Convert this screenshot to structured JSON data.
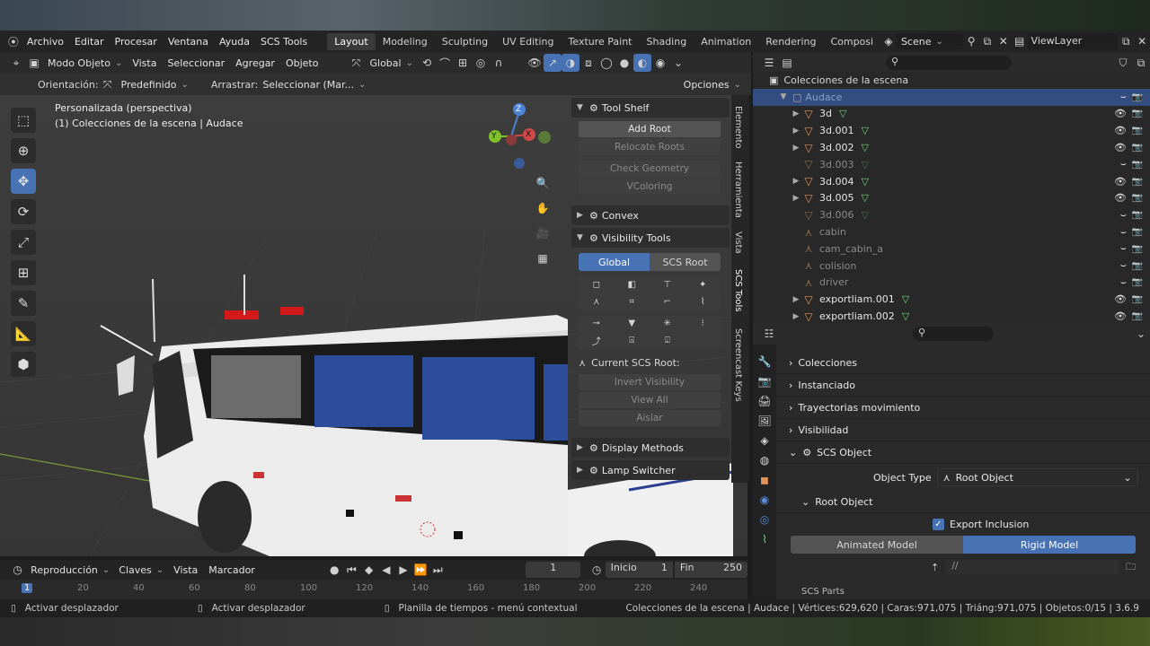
{
  "topbar": {
    "menus": [
      "Archivo",
      "Editar",
      "Procesar",
      "Ventana",
      "Ayuda",
      "SCS Tools"
    ],
    "workspaces": [
      "Layout",
      "Modeling",
      "Sculpting",
      "UV Editing",
      "Texture Paint",
      "Shading",
      "Animation",
      "Rendering",
      "Composi"
    ],
    "active_workspace": "Layout",
    "scene": "Scene",
    "view_layer": "ViewLayer"
  },
  "viewport_header": {
    "mode": "Modo Objeto",
    "menus": [
      "Vista",
      "Seleccionar",
      "Agregar",
      "Objeto"
    ],
    "transform": "Global",
    "orientation_label": "Orientación:",
    "orientation_value": "Predefinido",
    "drag_label": "Arrastrar:",
    "drag_value": "Seleccionar (Mar...",
    "options": "Opciones"
  },
  "viewport": {
    "view_name": "Personalizada (perspectiva)",
    "context": "(1) Colecciones de la escena | Audace",
    "gizmo": {
      "x": "X",
      "y": "Y",
      "z": "Z"
    }
  },
  "npanel": {
    "tool_shelf": "Tool Shelf",
    "add_root": "Add Root",
    "relocate_roots": "Relocate Roots",
    "check_geometry": "Check Geometry",
    "vcoloring": "VColoring",
    "convex": "Convex",
    "visibility_tools": "Visibility Tools",
    "global": "Global",
    "scs_root": "SCS Root",
    "current_root": "Current SCS Root:",
    "invert_visibility": "Invert Visibility",
    "view_all": "View All",
    "aislar": "Aislar",
    "display_methods": "Display Methods",
    "lamp_switcher": "Lamp Switcher",
    "tabs": [
      "Elemento",
      "Herramienta",
      "Vista",
      "SCS Tools",
      "Screencast Keys"
    ]
  },
  "outliner": {
    "header": "Colecciones de la escena",
    "active": "Audace",
    "items": [
      {
        "name": "3d",
        "mesh": true,
        "expand": true,
        "visible": true
      },
      {
        "name": "3d.001",
        "mesh": true,
        "expand": true,
        "visible": true
      },
      {
        "name": "3d.002",
        "mesh": true,
        "expand": true,
        "visible": true
      },
      {
        "name": "3d.003",
        "mesh": true,
        "expand": false,
        "visible": false
      },
      {
        "name": "3d.004",
        "mesh": true,
        "expand": true,
        "visible": true
      },
      {
        "name": "3d.005",
        "mesh": true,
        "expand": true,
        "visible": true
      },
      {
        "name": "3d.006",
        "mesh": true,
        "expand": false,
        "visible": false
      },
      {
        "name": "cabin",
        "mesh": false,
        "expand": false,
        "visible": false
      },
      {
        "name": "cam_cabin_a",
        "mesh": false,
        "expand": false,
        "visible": false
      },
      {
        "name": "colision",
        "mesh": false,
        "expand": false,
        "visible": false
      },
      {
        "name": "driver",
        "mesh": false,
        "expand": false,
        "visible": false
      },
      {
        "name": "exportliam.001",
        "mesh": true,
        "expand": true,
        "visible": true
      },
      {
        "name": "exportliam.002",
        "mesh": true,
        "expand": true,
        "visible": true
      }
    ]
  },
  "properties": {
    "colecciones": "Colecciones",
    "instanciado": "Instanciado",
    "trayectorias": "Trayectorias movimiento",
    "visibilidad": "Visibilidad",
    "scs_object": "SCS Object",
    "object_type_label": "Object Type",
    "object_type_value": "Root Object",
    "root_object": "Root Object",
    "export_inclusion": "Export Inclusion",
    "animated_model": "Animated Model",
    "rigid_model": "Rigid Model",
    "path": "//",
    "scs_parts": "SCS Parts"
  },
  "timeline": {
    "menus": [
      "Reproducción",
      "Claves",
      "Vista",
      "Marcador"
    ],
    "current_frame": "1",
    "start_label": "Inicio",
    "start": "1",
    "end_label": "Fin",
    "end": "250",
    "ticks": [
      "1",
      "20",
      "40",
      "60",
      "80",
      "100",
      "120",
      "140",
      "160",
      "180",
      "200",
      "220",
      "240"
    ]
  },
  "statusbar": {
    "left1": "Activar desplazador",
    "left2": "Activar desplazador",
    "middle": "Planilla de tiempos - menú contextual",
    "right": "Colecciones de la escena | Audace | Vértices:629,620 | Caras:971,075 | Triáng:971,075 | Objetos:0/15 | 3.6.9"
  },
  "colors": {
    "accent": "#4772b3",
    "mesh": "#6ad67a",
    "object": "#e2935a"
  }
}
